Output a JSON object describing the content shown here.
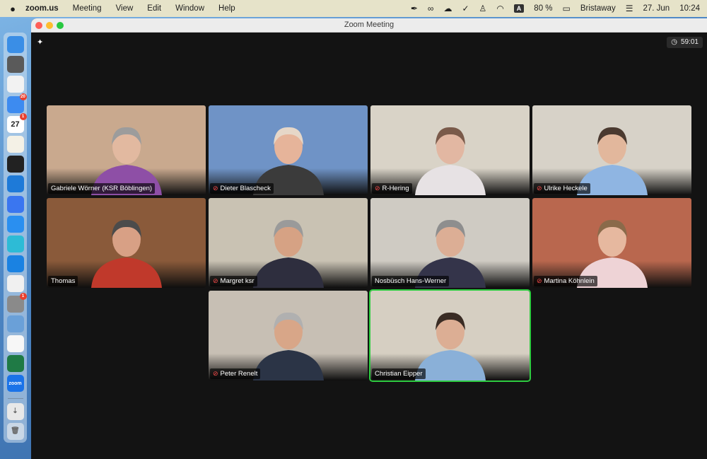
{
  "menubar": {
    "app_name": "zoom.us",
    "menus": [
      "Meeting",
      "View",
      "Edit",
      "Window",
      "Help"
    ],
    "battery": "80 %",
    "input_source": "A",
    "user": "Bristaway",
    "date": "27. Jun",
    "time": "10:24"
  },
  "dock": {
    "apps": [
      {
        "icon": "finder-icon",
        "color": "#3a8ee6",
        "badge": ""
      },
      {
        "icon": "printer-icon",
        "color": "#5a5a5a",
        "badge": ""
      },
      {
        "icon": "launchpad-icon",
        "color": "#f2f2f2",
        "badge": ""
      },
      {
        "icon": "mail-icon",
        "color": "#3d8bf0",
        "badge": "20"
      },
      {
        "icon": "calendar-icon",
        "color": "#ffffff",
        "badge": "1",
        "label": "27"
      },
      {
        "icon": "notes-icon",
        "color": "#f4f1e6",
        "badge": ""
      },
      {
        "icon": "terminal-icon",
        "color": "#222222",
        "badge": ""
      },
      {
        "icon": "vscode-icon",
        "color": "#1e7ad8",
        "badge": ""
      },
      {
        "icon": "signal-icon",
        "color": "#3a76f0",
        "badge": ""
      },
      {
        "icon": "safari-icon",
        "color": "#2a8ff0",
        "badge": ""
      },
      {
        "icon": "stack-icon",
        "color": "#2dbbd6",
        "badge": ""
      },
      {
        "icon": "nextcloud-icon",
        "color": "#1a82e2",
        "badge": ""
      },
      {
        "icon": "vlc-icon",
        "color": "#f0f0f0",
        "badge": ""
      },
      {
        "icon": "system-settings-icon",
        "color": "#8a8a8a",
        "badge": "1"
      },
      {
        "icon": "preview-icon",
        "color": "#6aa0d8",
        "badge": ""
      },
      {
        "icon": "textedit-icon",
        "color": "#f7f7f7",
        "badge": ""
      },
      {
        "icon": "excel-icon",
        "color": "#1f7a45",
        "badge": ""
      },
      {
        "icon": "zoom-icon",
        "color": "#1a73e8",
        "badge": "",
        "label": "zoom"
      }
    ],
    "extras": [
      "downloads-icon",
      "trash-icon"
    ]
  },
  "window": {
    "title": "Zoom Meeting",
    "timer": "59:01"
  },
  "participants": [
    {
      "name": "Gabriele Wörner (KSR Böblingen)",
      "muted": false,
      "active": false,
      "bg": "#c9a98e",
      "shirt": "#8e4fa6",
      "hair": "#9c9c9c",
      "skin": "#e2b9a0"
    },
    {
      "name": "Dieter Blascheck",
      "muted": true,
      "active": false,
      "bg": "#6f93c6",
      "shirt": "#3b3b3b",
      "hair": "#e6d7c8",
      "skin": "#e6b49a"
    },
    {
      "name": "R-Hering",
      "muted": true,
      "active": false,
      "bg": "#d9d3c7",
      "shirt": "#e7e2e4",
      "hair": "#7a5a4a",
      "skin": "#e2b7a2"
    },
    {
      "name": "Ulrike Heckele",
      "muted": true,
      "active": false,
      "bg": "#d7d2c8",
      "shirt": "#8fb5e2",
      "hair": "#4b3a30",
      "skin": "#e2b79c"
    },
    {
      "name": "Thomas",
      "muted": false,
      "active": false,
      "bg": "#8a5a3a",
      "shirt": "#c0392b",
      "hair": "#4b4b4b",
      "skin": "#d8a085"
    },
    {
      "name": "Margret ksr",
      "muted": true,
      "active": false,
      "bg": "#c9c2b3",
      "shirt": "#2e2e3e",
      "hair": "#9a9a9a",
      "skin": "#d6a284"
    },
    {
      "name": "Nosbüsch Hans-Werner",
      "muted": false,
      "active": false,
      "bg": "#cfcbc3",
      "shirt": "#34344a",
      "hair": "#8e8e8e",
      "skin": "#dcae95"
    },
    {
      "name": "Martina Köhnlein",
      "muted": true,
      "active": false,
      "bg": "#b9674e",
      "shirt": "#eed3d6",
      "hair": "#8a6a4a",
      "skin": "#e6b89f"
    },
    {
      "name": "Peter Renelt",
      "muted": true,
      "active": false,
      "bg": "#c7bfb4",
      "shirt": "#2b3446",
      "hair": "#b0b0b0",
      "skin": "#d8a688"
    },
    {
      "name": "Christian Eipper",
      "muted": false,
      "active": true,
      "bg": "#d6cfc2",
      "shirt": "#8ab0d8",
      "hair": "#3a2c24",
      "skin": "#dcae94"
    }
  ]
}
